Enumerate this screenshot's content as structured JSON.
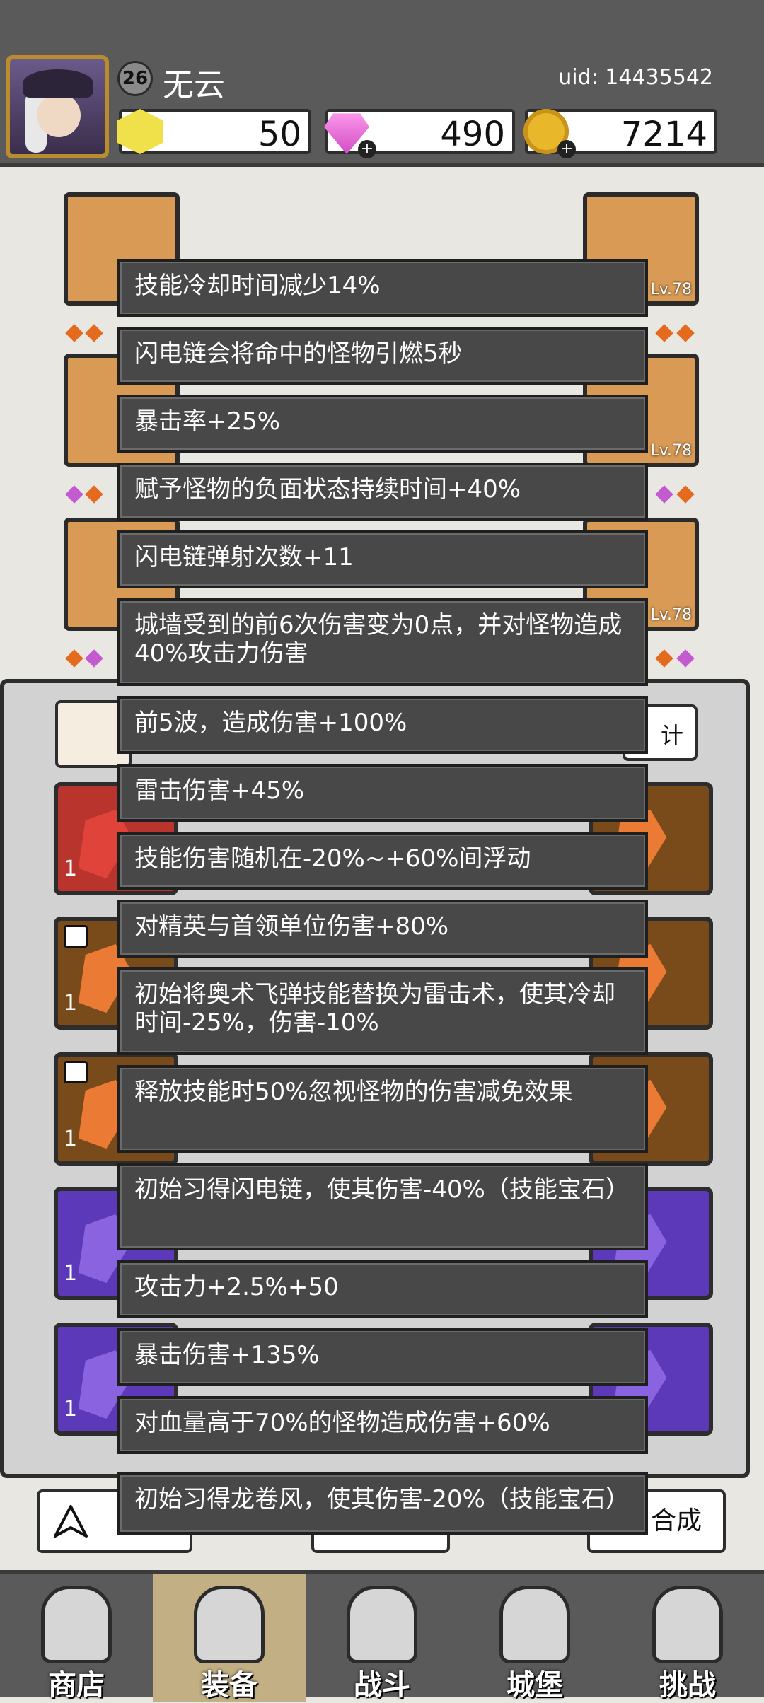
{
  "player": {
    "level": "26",
    "name": "无云",
    "uid": "uid: 14435542"
  },
  "resources": {
    "gems": "50",
    "diamonds": "490",
    "coins": "7214"
  },
  "equipment": {
    "level_labels": [
      "Lv.78",
      "Lv.78",
      "Lv.78",
      "Lv.78"
    ]
  },
  "panel": {
    "stats_button": "计",
    "gem_counts": [
      "1",
      "1",
      "1",
      "1",
      "1"
    ],
    "bottom_right_button": "合成"
  },
  "tooltip": {
    "lines": [
      "技能冷却时间减少14%",
      "闪电链会将命中的怪物引燃5秒",
      "暴击率+25%",
      "赋予怪物的负面状态持续时间+40%",
      "闪电链弹射次数+11",
      "城墙受到的前6次伤害变为0点，并对怪物造成40%攻击力伤害",
      "前5波，造成伤害+100%",
      "雷击伤害+45%",
      "技能伤害随机在-20%~+60%间浮动",
      "对精英与首领单位伤害+80%",
      "初始将奥术飞弹技能替换为雷击术，使其冷却时间-25%，伤害-10%",
      "释放技能时50%忽视怪物的伤害减免效果",
      "初始习得闪电链，使其伤害-40%（技能宝石）",
      "攻击力+2.5%+50",
      "暴击伤害+135%",
      "对血量高于70%的怪物造成伤害+60%",
      "初始习得龙卷风，使其伤害-20%（技能宝石）"
    ]
  },
  "nav": {
    "items": [
      "商店",
      "装备",
      "战斗",
      "城堡",
      "挑战"
    ],
    "active": "装备"
  },
  "colors": {
    "header_bg": "#5a5a5a",
    "tooltip_bg": "#484848",
    "nav_active": "#c2b084"
  }
}
